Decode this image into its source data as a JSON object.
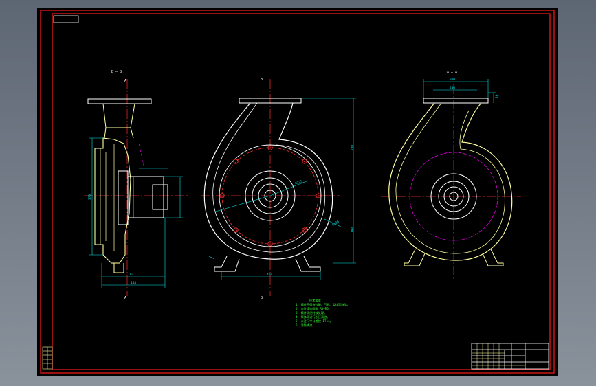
{
  "sheet": {
    "frame_color": "#ff1a1a",
    "line_color": "#ffffff",
    "dimension_color": "#00e5e5",
    "casting_color": "#ffffa0",
    "center_line_color": "#ff3030",
    "magenta_color": "#e000e0",
    "notes_color": "#33ff33"
  },
  "views": {
    "side_section": {
      "label_top": "B — B",
      "label_mark_top": "A",
      "label_mark_bottom": "A",
      "dim_height": "370",
      "dim_bottom_1": "102",
      "dim_bottom_2": "144"
    },
    "front": {
      "label_top": "B",
      "label_bottom": "B",
      "dim_upper_height": "270",
      "dim_lower_height": "190",
      "dim_radius": "R225",
      "dim_diameter": "Ø280",
      "dim_base_width": "420"
    },
    "section_aa": {
      "label_top": "A — A",
      "dim_flange_width": "300",
      "dim_flange_inner": "200",
      "dim_flange_side": "20"
    }
  },
  "notes": {
    "heading": "技术要求",
    "lines": [
      "1. 铸件不得有砂眼、气孔、裂纹等缺陷。",
      "2. 未注铸造圆角 R3~R5。",
      "3. 铸件须经时效处理。",
      "4. 泵体须进行水压试验。",
      "5. 未注尺寸公差按 IT14。",
      "6. 涂防锈漆。"
    ]
  },
  "title_block": {
    "rows": [
      "",
      "",
      "",
      ""
    ],
    "cells": [
      "",
      "",
      "",
      "",
      ""
    ]
  },
  "side_block": {
    "rows": [
      "",
      "",
      "",
      "",
      ""
    ]
  }
}
